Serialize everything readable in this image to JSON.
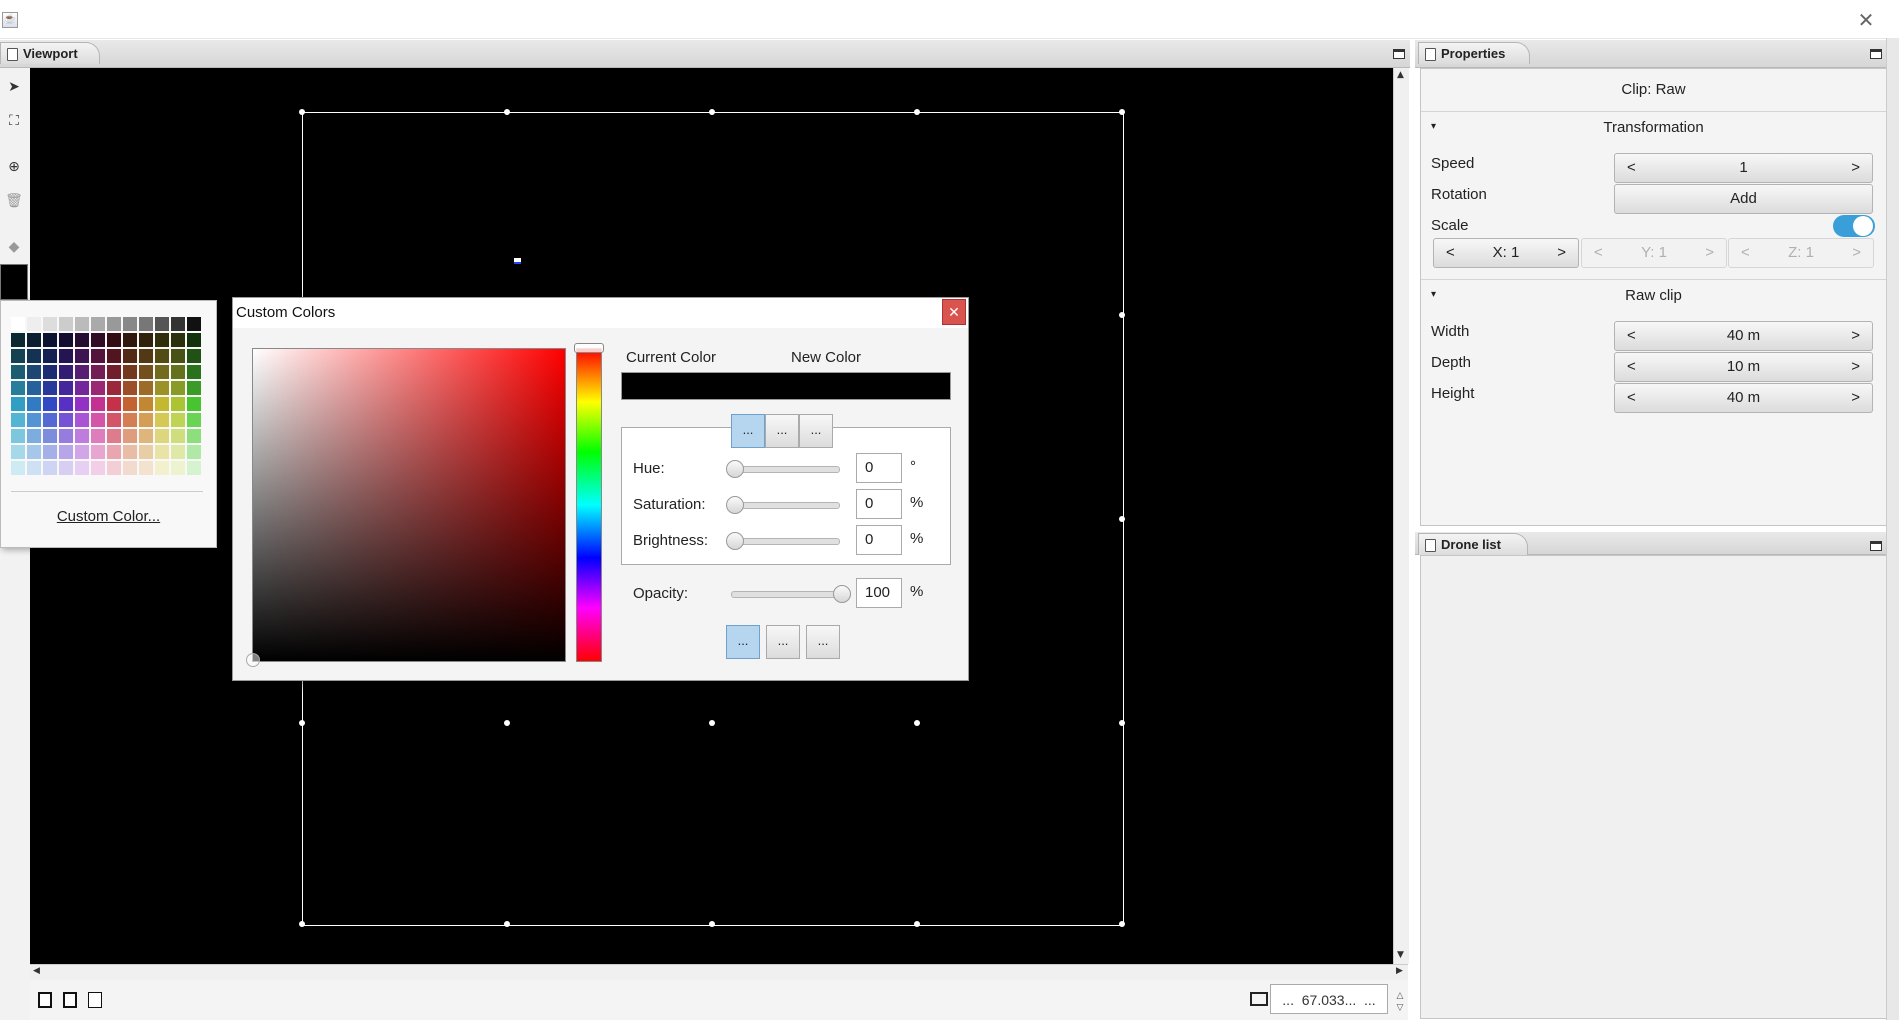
{
  "window": {
    "close_glyph": "✕"
  },
  "viewport": {
    "tab_label": "Viewport",
    "toolbar_icons": [
      "select-arrow-icon",
      "fit-view-icon",
      "add-circle-icon",
      "trash-icon",
      "paint-bucket-icon"
    ],
    "zoom_value": "67.033...",
    "zoom_more": "...",
    "prev_glyph": "...",
    "canvas_color": "#000000"
  },
  "palette": {
    "custom_color_link": "Custom Color..."
  },
  "dialog": {
    "title": "Custom Colors",
    "close_glyph": "✕",
    "current_color_label": "Current Color",
    "new_color_label": "New Color",
    "mode_buttons": [
      "...",
      "...",
      "..."
    ],
    "hue_label": "Hue:",
    "hue_value": "0",
    "hue_unit": "°",
    "saturation_label": "Saturation:",
    "saturation_value": "0",
    "saturation_unit": "%",
    "brightness_label": "Brightness:",
    "brightness_value": "0",
    "brightness_unit": "%",
    "opacity_label": "Opacity:",
    "opacity_value": "100",
    "opacity_unit": "%",
    "action_buttons": [
      "...",
      "...",
      "..."
    ]
  },
  "properties": {
    "tab_label": "Properties",
    "clip_title": "Clip: Raw",
    "transformation": {
      "header": "Transformation",
      "speed_label": "Speed",
      "speed_value": "1",
      "rotation_label": "Rotation",
      "rotation_button": "Add",
      "scale_label": "Scale",
      "scale_x": "X: 1",
      "scale_y": "Y: 1",
      "scale_z": "Z: 1",
      "scale_enabled": true
    },
    "raw_clip": {
      "header": "Raw clip",
      "width_label": "Width",
      "width_value": "40 m",
      "depth_label": "Depth",
      "depth_value": "10 m",
      "height_label": "Height",
      "height_value": "40 m"
    },
    "spinner_left": "<",
    "spinner_right": ">"
  },
  "drone_list": {
    "tab_label": "Drone list"
  },
  "colors": {
    "accent": "#3a9fd8",
    "dialog_close": "#d9534f",
    "selected_button": "#b5d6ee"
  }
}
